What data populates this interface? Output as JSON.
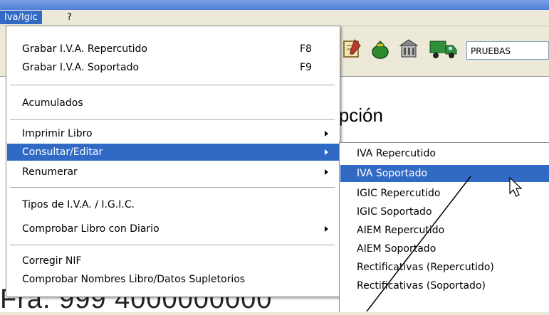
{
  "menubar": {
    "items": [
      "Iva/Igic",
      "?"
    ]
  },
  "toolbar": {
    "icons": [
      "notepad-icon",
      "money-bag-icon",
      "building-icon",
      "truck-icon"
    ],
    "company_field": "PRUEBAS"
  },
  "background": {
    "heading": "ipción",
    "number": "Fra. 999 4000000000"
  },
  "menu": {
    "group1": [
      {
        "label": "Grabar I.V.A. Repercutido",
        "shortcut": "F8"
      },
      {
        "label": "Grabar I.V.A. Soportado",
        "shortcut": "F9"
      }
    ],
    "group2": [
      {
        "label": "Acumulados"
      }
    ],
    "group3": [
      {
        "label": "Imprimir Libro"
      },
      {
        "label": "Consultar/Editar"
      },
      {
        "label": "Renumerar"
      }
    ],
    "group4": [
      {
        "label": "Tipos de I.V.A. / I.G.I.C."
      },
      {
        "label": "Comprobar Libro con Diario"
      }
    ],
    "group5": [
      {
        "label": "Corregir NIF"
      },
      {
        "label": "Comprobar Nombres Libro/Datos Supletorios"
      }
    ]
  },
  "submenu": {
    "items": [
      "IVA Repercutido",
      "IVA Soportado",
      "IGIC Repercutido",
      "IGIC Soportado",
      "AIEM Repercutido",
      "AIEM Soportado",
      "Rectificativas (Repercutido)",
      "Rectificativas (Soportado)"
    ]
  },
  "colors": {
    "highlight": "#316ac5",
    "menu_bg": "#ffffff",
    "bar_bg": "#ece9d8"
  }
}
